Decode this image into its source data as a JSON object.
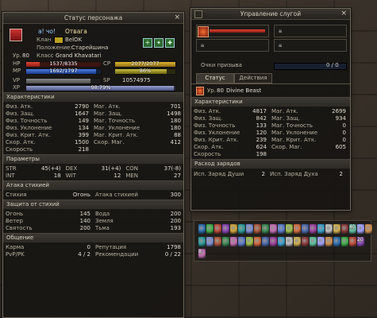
{
  "char": {
    "title": "Статус персонажа",
    "name": "a! чо!",
    "nickname": "Отвага",
    "clan_label": "Клан",
    "clan_name": "BelOK",
    "position_label": "Положение:",
    "position_value": "Старейшина",
    "level_label": "Ур.",
    "level": "80",
    "class_label": "Класс",
    "class_value": "Grand Khavatari",
    "hp_label": "HP",
    "hp": "1537/8335",
    "mp_label": "MP",
    "mp": "1692/1797",
    "vp_label": "VP",
    "xp_label": "XP",
    "xp": "98.79%",
    "cp_label": "CP",
    "cp": "2077/2077",
    "sp_pct": "86%",
    "sp_label": "SP",
    "sp": "10574975",
    "hp_frac": 0.18,
    "mp_frac": 0.94,
    "cp_frac": 1.0,
    "xp_frac": 0.99,
    "vp_frac": 0.86,
    "stats_title": "Характеристики",
    "stats": [
      [
        "Физ. Атк.",
        "2790",
        "Маг. Атк.",
        "701"
      ],
      [
        "Физ. Защ.",
        "1647",
        "Маг. Защ.",
        "1498"
      ],
      [
        "Физ. Точность",
        "149",
        "Маг. Точность",
        "180"
      ],
      [
        "Физ. Уклонение",
        "134",
        "Маг. Уклонение",
        "180"
      ],
      [
        "Физ. Крит. Атк.",
        "399",
        "Маг. Крит. Атк.",
        "88"
      ],
      [
        "Скор. Атк.",
        "1500",
        "Скор. Маг.",
        "412"
      ],
      [
        "Скорость",
        "218",
        "",
        ""
      ]
    ],
    "params_title": "Параметры",
    "params": [
      [
        "STR",
        "45(+4)",
        "DEX",
        "31(+4)",
        "CON",
        "37(-8)"
      ],
      [
        "INT",
        "18",
        "WIT",
        "12",
        "MEN",
        "27"
      ]
    ],
    "attack_title": "Атака стихией",
    "attack_row": [
      "Стихия",
      "Огонь",
      "Атака стихией",
      "300"
    ],
    "defense_title": "Защита от стихий",
    "defense": [
      [
        "Огонь",
        "145",
        "Вода",
        "200"
      ],
      [
        "Ветер",
        "140",
        "Земля",
        "200"
      ],
      [
        "Святость",
        "200",
        "Тьма",
        "193"
      ]
    ],
    "social_title": "Общение",
    "social": [
      [
        "Карма",
        "0",
        "Репутация",
        "1798"
      ],
      [
        "PvP/PK",
        "4 / 2",
        "Рекомендации",
        "0 / 22"
      ]
    ]
  },
  "servitor": {
    "title": "Управление слугой",
    "summon_label": "Очки призыва",
    "summon_value": "0 / 0",
    "tab_status": "Статус",
    "tab_actions": "Действия",
    "level_label": "Ур.",
    "level": "80",
    "name": "Divine Beast",
    "stats_title": "Характеристики",
    "stats": [
      [
        "Физ. Атк.",
        "4817",
        "Маг. Атк.",
        "2699"
      ],
      [
        "Физ. Защ.",
        "842",
        "Маг. Защ.",
        "934"
      ],
      [
        "Физ. Точность",
        "133",
        "Маг. Точность",
        "0"
      ],
      [
        "Физ. Уклонение",
        "120",
        "Маг. Уклонение",
        "0"
      ],
      [
        "Физ. Крит. Атк.",
        "239",
        "Маг. Крит. Атк.",
        "0"
      ],
      [
        "Скор. Атк.",
        "624",
        "Скор. Маг.",
        "605"
      ],
      [
        "Скорость",
        "198",
        "",
        ""
      ]
    ],
    "charges_title": "Расход зарядов",
    "charges": [
      "Исп. Заряд Души",
      "2",
      "Исп. Заряд Духа",
      "2"
    ]
  },
  "buffs": {
    "row1_badges": [
      "",
      "",
      "",
      "",
      "",
      "",
      "",
      "",
      "",
      "",
      "",
      "",
      "",
      "",
      "",
      "",
      "",
      "",
      "",
      "40",
      "",
      ""
    ],
    "row2_badges": [
      "",
      "",
      "",
      "",
      "",
      "",
      "",
      "",
      "",
      "",
      "",
      "",
      "",
      "",
      "",
      "",
      "",
      "",
      "",
      "",
      "20"
    ],
    "row3_badges": [
      "8"
    ],
    "colors": [
      "#2b6fb3",
      "#3fae4a",
      "#c04a3a",
      "#8a44b8",
      "#d0a53a",
      "#2a9c9c",
      "#7d8fd6",
      "#b0573a",
      "#3b8a52",
      "#c46bb2",
      "#5a7bd0",
      "#9cc04a",
      "#d46a3a",
      "#4a6ab0",
      "#a040a0",
      "#3aa0d0",
      "#c0c0c0",
      "#d4b050",
      "#8b3a3a",
      "#5ec0a0",
      "#a0a0ff",
      "#d09050"
    ]
  }
}
